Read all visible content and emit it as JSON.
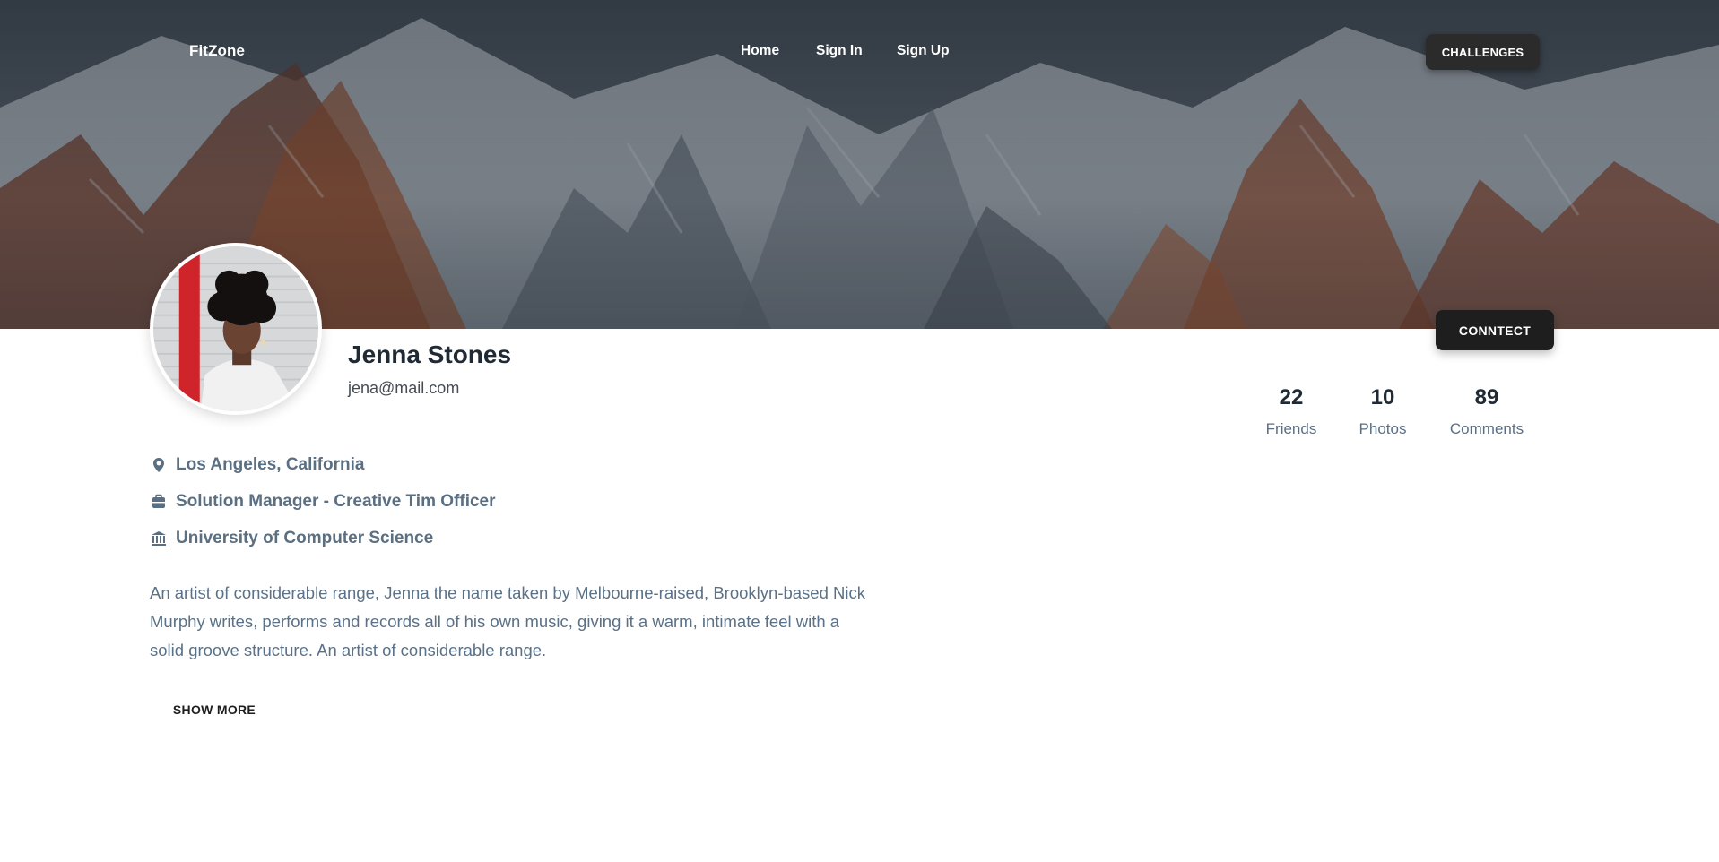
{
  "navbar": {
    "brand": "FitZone",
    "links": [
      "Home",
      "Sign In",
      "Sign Up"
    ],
    "cta": "CHALLENGES"
  },
  "profile": {
    "name": "Jenna Stones",
    "email": "jena@mail.com",
    "connect_label": "CONNTECT",
    "stats": [
      {
        "value": "22",
        "label": "Friends"
      },
      {
        "value": "10",
        "label": "Photos"
      },
      {
        "value": "89",
        "label": "Comments"
      }
    ],
    "details": [
      {
        "icon": "location-pin-icon",
        "text": "Los Angeles, California"
      },
      {
        "icon": "briefcase-icon",
        "text": "Solution Manager - Creative Tim Officer"
      },
      {
        "icon": "university-icon",
        "text": "University of Computer Science"
      }
    ],
    "bio": "An artist of considerable range, Jenna the name taken by Melbourne-raised, Brooklyn-based Nick Murphy writes, performs and records all of his own music, giving it a warm, intimate feel with a solid groove structure. An artist of considerable range.",
    "show_more_label": "SHOW MORE"
  },
  "colors": {
    "heading": "#1f2a35",
    "muted": "#5a7187",
    "button_dark": "#1e1e1e"
  }
}
